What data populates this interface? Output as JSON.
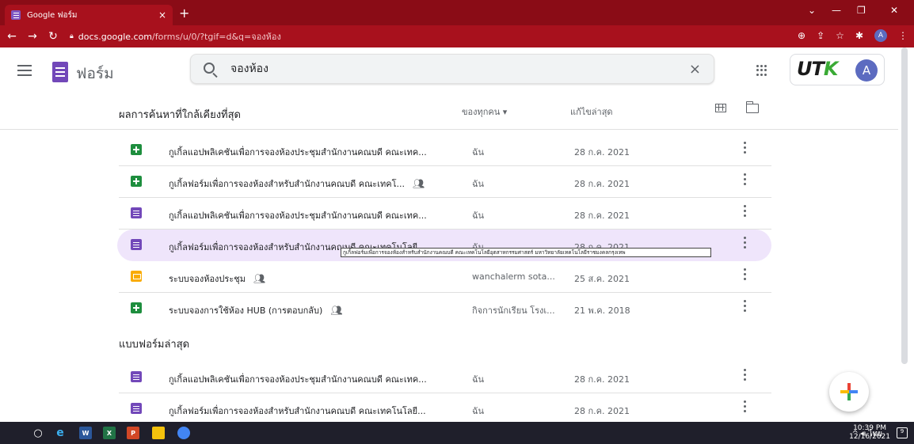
{
  "browser": {
    "tab_title": "Google ฟอร์ม",
    "tab_close": "×",
    "new_tab": "+",
    "url_domain": "docs.google.com",
    "url_path": "/forms/u/0/?tgif=d&q=จองห้อง",
    "profile_initial": "A"
  },
  "app": {
    "name": "ฟอร์ม",
    "search_value": "จองห้อง",
    "search_clear": "×",
    "brand_prefix": "UT",
    "brand_suffix": "K",
    "avatar_initial": "A"
  },
  "list_header": {
    "title": "ผลการค้นหาที่ใกล้เคียงที่สุด",
    "owner_filter": "ของทุกคน ▾",
    "sort": "แก้ไขล่าสุด"
  },
  "results": [
    {
      "icon": "sheets",
      "name": "กูเกิ้ลแอปพลิเคชันเพื่อการจองห้องประชุมสำนักงานคณบดี คณะเทค...",
      "shared": false,
      "owner": "ฉัน",
      "date": "28 ก.ค. 2021"
    },
    {
      "icon": "sheets",
      "name": "กูเกิ้ลฟอร์มเพื่อการจองห้องสำหรับสำนักงานคณบดี คณะเทคโ...",
      "shared": true,
      "owner": "ฉัน",
      "date": "28 ก.ค. 2021"
    },
    {
      "icon": "forms",
      "name": "กูเกิ้ลแอปพลิเคชันเพื่อการจองห้องประชุมสำนักงานคณบดี คณะเทค...",
      "shared": false,
      "owner": "ฉัน",
      "date": "28 ก.ค. 2021"
    },
    {
      "icon": "forms",
      "name": "กูเกิ้ลฟอร์มเพื่อการจองห้องสำหรับสำนักงานคณบดี คณะเทคโนโลยี...",
      "shared": false,
      "owner": "ฉัน",
      "date": "28 ก.ค. 2021"
    },
    {
      "icon": "slides",
      "name": "ระบบจองห้องประชุม",
      "shared": true,
      "owner": "wanchalerm sota...",
      "date": "25 ส.ค. 2021"
    },
    {
      "icon": "sheets",
      "name": "ระบบจองการใช้ห้อง HUB (การตอบกลับ)",
      "shared": true,
      "owner": "กิจการนักเรียน โรงเ...",
      "date": "21 พ.ค. 2018"
    }
  ],
  "tooltip": "กูเกิ้ลฟอร์มเพื่อการจองห้องสำหรับสำนักงานคณบดี คณะเทคโนโลยีอุตสาหกรรมศาสตร์ มหาวิทยาลัยเทคโนโลยีราชมงคลกรุงเทพ",
  "recent_section_title": "แบบฟอร์มล่าสุด",
  "recent": [
    {
      "icon": "forms",
      "name": "กูเกิ้ลแอปพลิเคชันเพื่อการจองห้องประชุมสำนักงานคณบดี คณะเทค...",
      "owner": "ฉัน",
      "date": "28 ก.ค. 2021"
    },
    {
      "icon": "forms",
      "name": "กูเกิ้ลฟอร์มเพื่อการจองห้องสำหรับสำนักงานคณบดี คณะเทคโนโลยี...",
      "owner": "ฉัน",
      "date": "28 ก.ค. 2021"
    }
  ],
  "taskbar": {
    "word": "W",
    "excel": "X",
    "powerpoint": "P",
    "lang": "ไทย",
    "time": "10:39 PM",
    "date": "12/16/2021",
    "notif_count": "9"
  },
  "colors": {
    "chrome_frame": "#8a0c16",
    "forms_purple": "#7248b9",
    "sheets_green": "#1e8e3e",
    "slides_yellow": "#f9ab00",
    "selected_row": "#efe5fb"
  }
}
